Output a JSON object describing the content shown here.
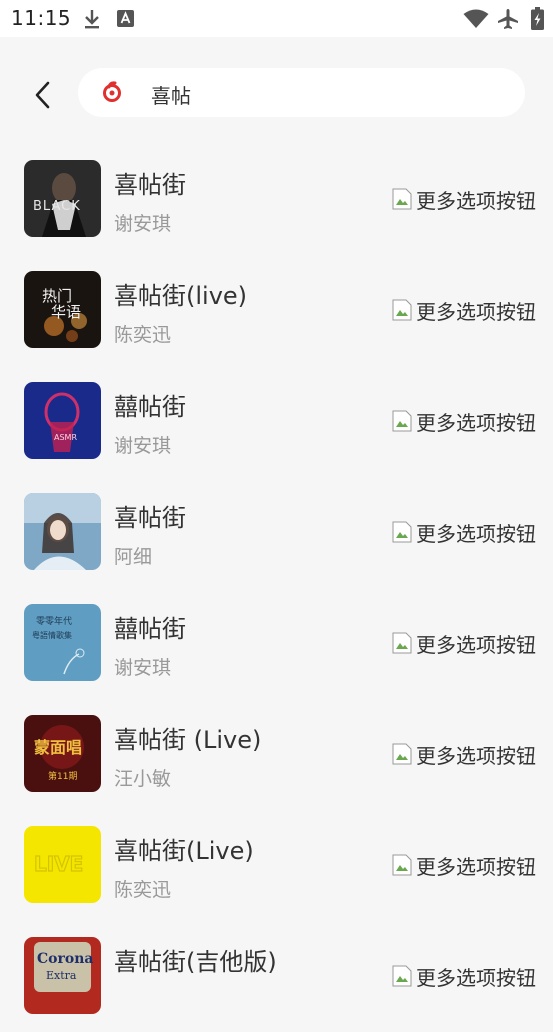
{
  "status_bar": {
    "time": "11:15",
    "icons": [
      "download-icon",
      "font-icon",
      "wifi-icon",
      "airplane-icon",
      "battery-charging-icon"
    ]
  },
  "search": {
    "query": "喜帖",
    "logo_icon": "netease-music-logo-icon",
    "back_icon": "chevron-left-icon"
  },
  "more_alt": "更多选项按钮",
  "songs": [
    {
      "title": "喜帖街",
      "artist": "谢安琪"
    },
    {
      "title": "喜帖街(live)",
      "artist": "陈奕迅"
    },
    {
      "title": "囍帖街",
      "artist": "谢安琪"
    },
    {
      "title": "喜帖街",
      "artist": "阿细"
    },
    {
      "title": "囍帖街",
      "artist": "谢安琪"
    },
    {
      "title": "喜帖街 (Live)",
      "artist": "汪小敏"
    },
    {
      "title": "喜帖街(Live)",
      "artist": "陈奕迅"
    },
    {
      "title": "喜帖街(吉他版)",
      "artist": ""
    }
  ],
  "covers": [
    {
      "label": "BLACK",
      "bg": "#2b2b2b"
    },
    {
      "label": "热门 华语",
      "bg": "#1a1410"
    },
    {
      "label": "",
      "bg": "#1a2a8a"
    },
    {
      "label": "",
      "bg": "#7fa8c7"
    },
    {
      "label": "零零年代 粤語情歌集",
      "bg": "#5f9ec2"
    },
    {
      "label": "第11期",
      "bg": "#4a0f0f"
    },
    {
      "label": "LIVE",
      "bg": "#f5e600"
    },
    {
      "label": "Corona Extra",
      "bg": "#b22a1f"
    }
  ]
}
